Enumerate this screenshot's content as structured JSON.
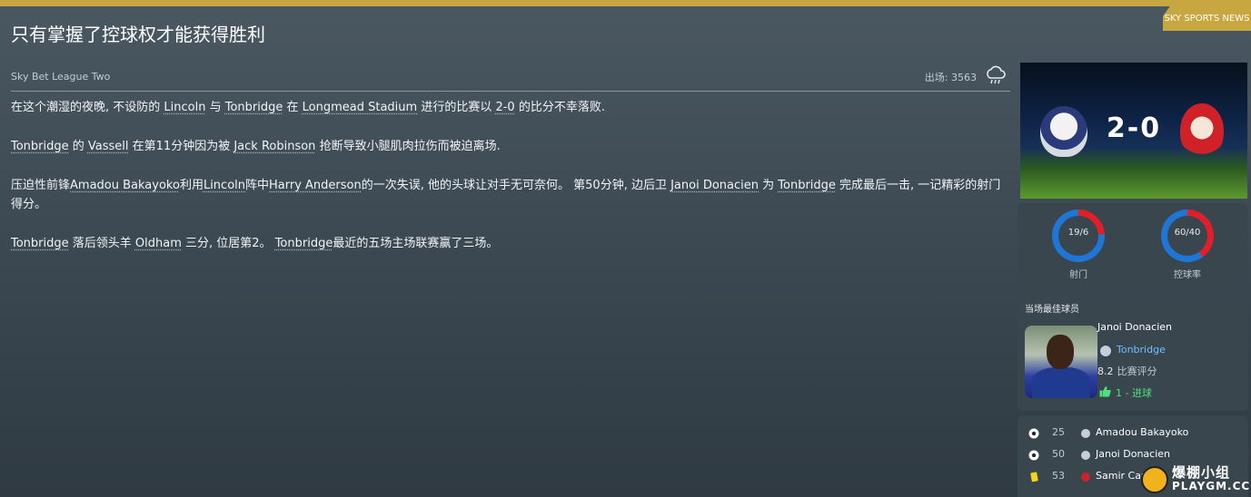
{
  "header": {
    "source_label": "SKY SPORTS NEWS",
    "headline": "只有掌握了控球权才能获得胜利"
  },
  "meta": {
    "competition": "Sky Bet League Two",
    "attendance": "出场: 3563",
    "weather_icon": "rain-cloud-icon"
  },
  "article": {
    "p1": {
      "a": "在这个潮湿的夜晚, 不设防的 ",
      "team_away": "Lincoln",
      "b": " 与 ",
      "team_home": "Tonbridge",
      "c": " 在 ",
      "stadium": "Longmead Stadium",
      "d": " 进行的比赛以 ",
      "score": "2-0",
      "e": " 的比分不幸落败."
    },
    "p2": {
      "team": "Tonbridge",
      "a": " 的 ",
      "player1": "Vassell",
      "b": " 在第11分钟因为被 ",
      "player2": "Jack Robinson",
      "c": " 抢断导致小腿肌肉拉伤而被迫离场."
    },
    "p3": {
      "a": "压迫性前锋",
      "player1": "Amadou Bakayoko",
      "b": "利用",
      "team1": "Lincoln",
      "c": "阵中",
      "player2": "Harry Anderson",
      "d": "的一次失误, 他的头球让对手无可奈何。 第50分钟, 边后卫 ",
      "player3": "Janoi Donacien",
      "e": " 为 ",
      "team2": "Tonbridge",
      "f": " 完成最后一击, 一记精彩的射门得分。"
    },
    "p4": {
      "team": "Tonbridge",
      "a": " 落后领头羊 ",
      "leader": "Oldham",
      "b": " 三分, 位居第2。 ",
      "team2": "Tonbridge",
      "c": "最近的五场主场联赛赢了三场。"
    }
  },
  "scoreboard": {
    "home_crest": "tonbridge-crest-icon",
    "away_crest": "lincoln-city-crest-icon",
    "score": "2-0"
  },
  "stats": {
    "shots_value": "19/6",
    "shots_label": "射门",
    "possession_value": "60/40",
    "possession_label": "控球率",
    "home_color": "#1e77d6",
    "away_color": "#e31e2b"
  },
  "motm": {
    "title": "当场最佳球员",
    "name": "Janoi Donacien",
    "club": "Tonbridge",
    "rating": "8.2",
    "rating_label": "比赛评分",
    "goals": "1 - 进球"
  },
  "events": [
    {
      "minute": "25",
      "player": "Amadou Bakayoko",
      "type": "goal"
    },
    {
      "minute": "50",
      "player": "Janoi Donacien",
      "type": "goal"
    },
    {
      "minute": "53",
      "player": "Samir Carr",
      "type": "yellow-card"
    }
  ],
  "watermark": {
    "line1": "爆棚小组",
    "line2": "PLAYGM.CC"
  }
}
